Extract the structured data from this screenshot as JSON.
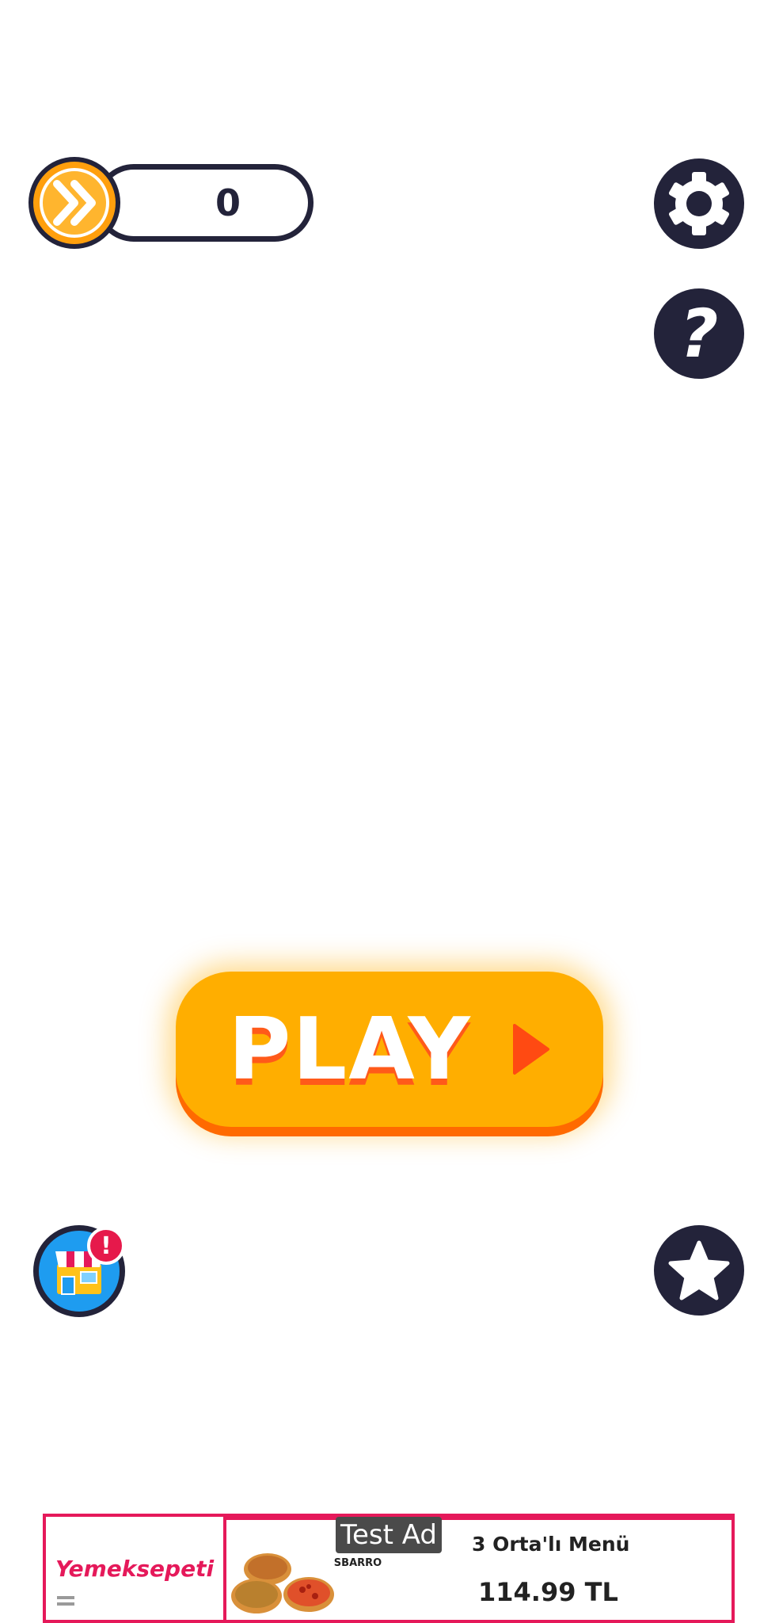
{
  "hud": {
    "skip_count": "0",
    "coin_icon": "fast-forward-coin-icon"
  },
  "buttons": {
    "settings_icon": "gear-icon",
    "help_label": "?",
    "play_label": "PLAY",
    "shop_icon": "shop-icon",
    "shop_badge": "!",
    "favorites_icon": "star-icon"
  },
  "ad": {
    "badge": "Test Ad",
    "brand": "Yemeksepeti",
    "logo": "SBARRO",
    "title": "3 Orta'lı Menü",
    "price": "114.99 TL"
  },
  "colors": {
    "dark": "#23233a",
    "play_orange": "#ffae00",
    "play_shadow": "#ff6a00",
    "shop_blue": "#1e9cf0",
    "ad_pink": "#e5195a"
  }
}
